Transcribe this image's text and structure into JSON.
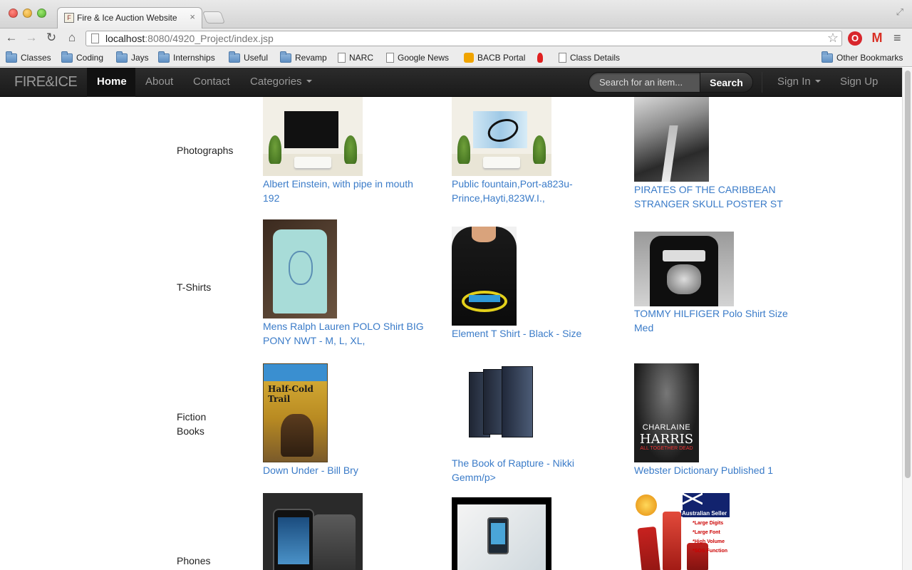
{
  "browser": {
    "tab_title": "Fire & Ice Auction Website",
    "url_host": "localhost",
    "url_rest": ":8080/4920_Project/index.jsp",
    "bookmarks": [
      {
        "label": "Classes",
        "icon": "folder-icon"
      },
      {
        "label": "Coding",
        "icon": "folder-icon"
      },
      {
        "label": "Jays",
        "icon": "folder-icon"
      },
      {
        "label": "Internships",
        "icon": "folder-icon"
      },
      {
        "label": "Useful",
        "icon": "folder-icon"
      },
      {
        "label": "Revamp",
        "icon": "folder-icon"
      },
      {
        "label": "NARC",
        "icon": "doc-icon"
      },
      {
        "label": "Google News",
        "icon": "doc-icon"
      },
      {
        "label": "BACB Portal",
        "icon": "rss-icon"
      },
      {
        "label": "",
        "icon": "flame-icon"
      },
      {
        "label": "Class Details",
        "icon": "doc-icon"
      },
      {
        "label": "Other Bookmarks",
        "icon": "folder-icon"
      }
    ]
  },
  "navbar": {
    "brand": "FIRE&ICE",
    "home": "Home",
    "about": "About",
    "contact": "Contact",
    "categories": "Categories",
    "search_placeholder": "Search for an item...",
    "search_button": "Search",
    "sign_in": "Sign In",
    "sign_up": "Sign Up"
  },
  "categories": [
    {
      "name": "Photographs",
      "items": [
        {
          "title": "Albert Einstein, with pipe in mouth 192"
        },
        {
          "title": "Public fountain,Port-a823u-Prince,Hayti,823W.I.,"
        },
        {
          "title": "PIRATES OF THE CARIBBEAN STRANGER SKULL POSTER ST"
        }
      ]
    },
    {
      "name": "T-Shirts",
      "items": [
        {
          "title": "Mens Ralph Lauren POLO Shirt BIG PONY NWT - M, L, XL,"
        },
        {
          "title": "Element T Shirt - Black - Size"
        },
        {
          "title": "TOMMY HILFIGER Polo Shirt Size Med"
        }
      ]
    },
    {
      "name": "Fiction Books",
      "items": [
        {
          "title": "Down Under - Bill Bry"
        },
        {
          "title": "The Book of Rapture - Nikki Gemm/p>"
        },
        {
          "title": "Webster Dictionary Published 1"
        }
      ]
    },
    {
      "name": "Phones",
      "items": [
        {
          "title": ""
        },
        {
          "title": ""
        },
        {
          "title": ""
        }
      ]
    }
  ],
  "thumbnail_text": {
    "book1_name": "Half-Cold Trail",
    "harris_line1": "CHARLAINE",
    "harris_line2": "HARRIS",
    "harris_line3": "ALL TOGETHER DEAD",
    "phone3_label": "Australian Seller",
    "phone3_features": "*Large Digits\n*Large Font\n*High Volume\n*SOS Function"
  },
  "colors": {
    "link": "#3a7bc8",
    "navbar_bg": "#1f1f1f"
  }
}
